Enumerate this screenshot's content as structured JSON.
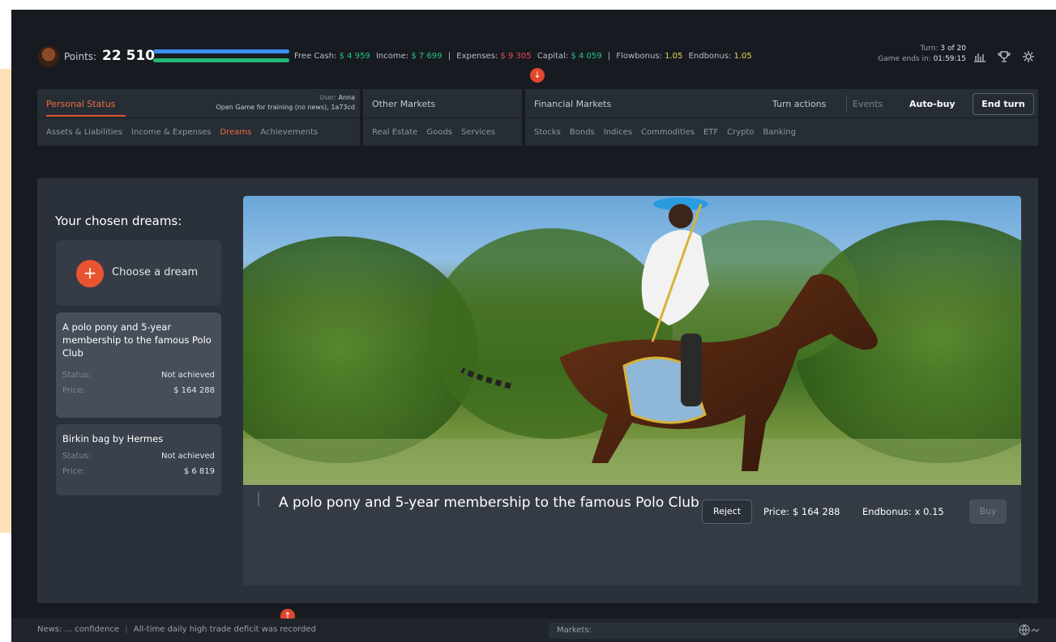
{
  "topbar": {
    "points_label": "Points:",
    "points_value": "22 510",
    "free_cash_label": "Free Cash:",
    "free_cash_value": "$ 4 959",
    "income_label": "Income:",
    "income_value": "$ 7 699",
    "expenses_label": "Expenses:",
    "expenses_value": "$ 9 305",
    "capital_label": "Capital:",
    "capital_value": "$ 4 059",
    "flowbonus_label": "Flowbonus:",
    "flowbonus_value": "1.05",
    "endbonus_label": "Endbonus:",
    "endbonus_value": "1.05",
    "turn_label": "Turn:",
    "turn_value": "3 of 20",
    "game_ends_label": "Game ends in:",
    "game_ends_value": "01:59:15",
    "icons": [
      "chart-icon",
      "trophy-icon",
      "settings-icon"
    ]
  },
  "nav_personal": {
    "title": "Personal Status",
    "game_user": "Anna",
    "game_desc": "Open Game for training (no news), 1a73cd",
    "tabs": [
      "Assets & Liabilities",
      "Income & Expenses",
      "Dreams",
      "Achievements"
    ],
    "active_tab": "Dreams"
  },
  "nav_other": {
    "title": "Other Markets",
    "tabs": [
      "Real Estate",
      "Goods",
      "Services"
    ]
  },
  "nav_financial": {
    "title": "Financial Markets",
    "tabs": [
      "Stocks",
      "Bonds",
      "Indices",
      "Commodities",
      "ETF",
      "Crypto",
      "Banking"
    ],
    "turn_actions": "Turn actions",
    "events": "Events",
    "auto_buy": "Auto-buy",
    "end_turn": "End turn"
  },
  "dreams": {
    "title": "Your chosen dreams:",
    "choose_label": "Choose a dream",
    "items": [
      {
        "title": "A polo pony and 5-year membership to the famous Polo Club",
        "status_label": "Status:",
        "status_value": "Not achieved",
        "price_label": "Price:",
        "price_value": "$ 164 288"
      },
      {
        "title": "Birkin bag by Hermes",
        "status_label": "Status:",
        "status_value": "Not achieved",
        "price_label": "Price:",
        "price_value": "$ 6 819"
      }
    ]
  },
  "detail": {
    "title": "A polo pony and 5-year membership to the famous Polo Club",
    "reject": "Reject",
    "price_label": "Price:",
    "price_value": "$ 164 288",
    "endbonus_label": "Endbonus:",
    "endbonus_value": "x 0.15",
    "buy": "Buy"
  },
  "bottombar": {
    "news_label": "News:",
    "news_item1": "... confidence",
    "news_item2": "All-time daily high trade deficit was recorded",
    "markets_label": "Markets:"
  }
}
